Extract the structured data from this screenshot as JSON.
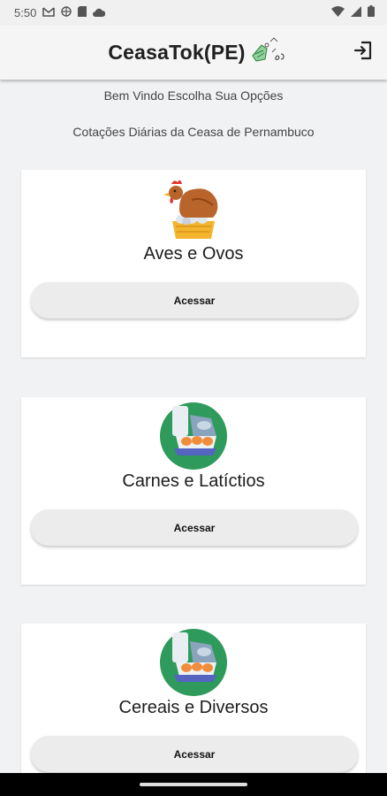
{
  "status_bar": {
    "time": "5:50"
  },
  "app_bar": {
    "title": "CeasaTok(PE)"
  },
  "header": {
    "welcome": "Bem Vindo Escolha Sua Opções",
    "subtitle": "Cotações Diárias da Ceasa de Pernambuco"
  },
  "cards": [
    {
      "title": "Aves e Ovos",
      "button_label": "Acessar",
      "icon": "chicken-eggs-icon"
    },
    {
      "title": "Carnes e Latíctios",
      "button_label": "Acessar",
      "icon": "meat-dairy-icon"
    },
    {
      "title": "Cereais e Diversos",
      "button_label": "Acessar",
      "icon": "cereals-misc-icon"
    }
  ],
  "colors": {
    "background": "#f1f2f4",
    "card": "#ffffff",
    "button": "#ececec",
    "icon_green": "#2e9a5c"
  }
}
